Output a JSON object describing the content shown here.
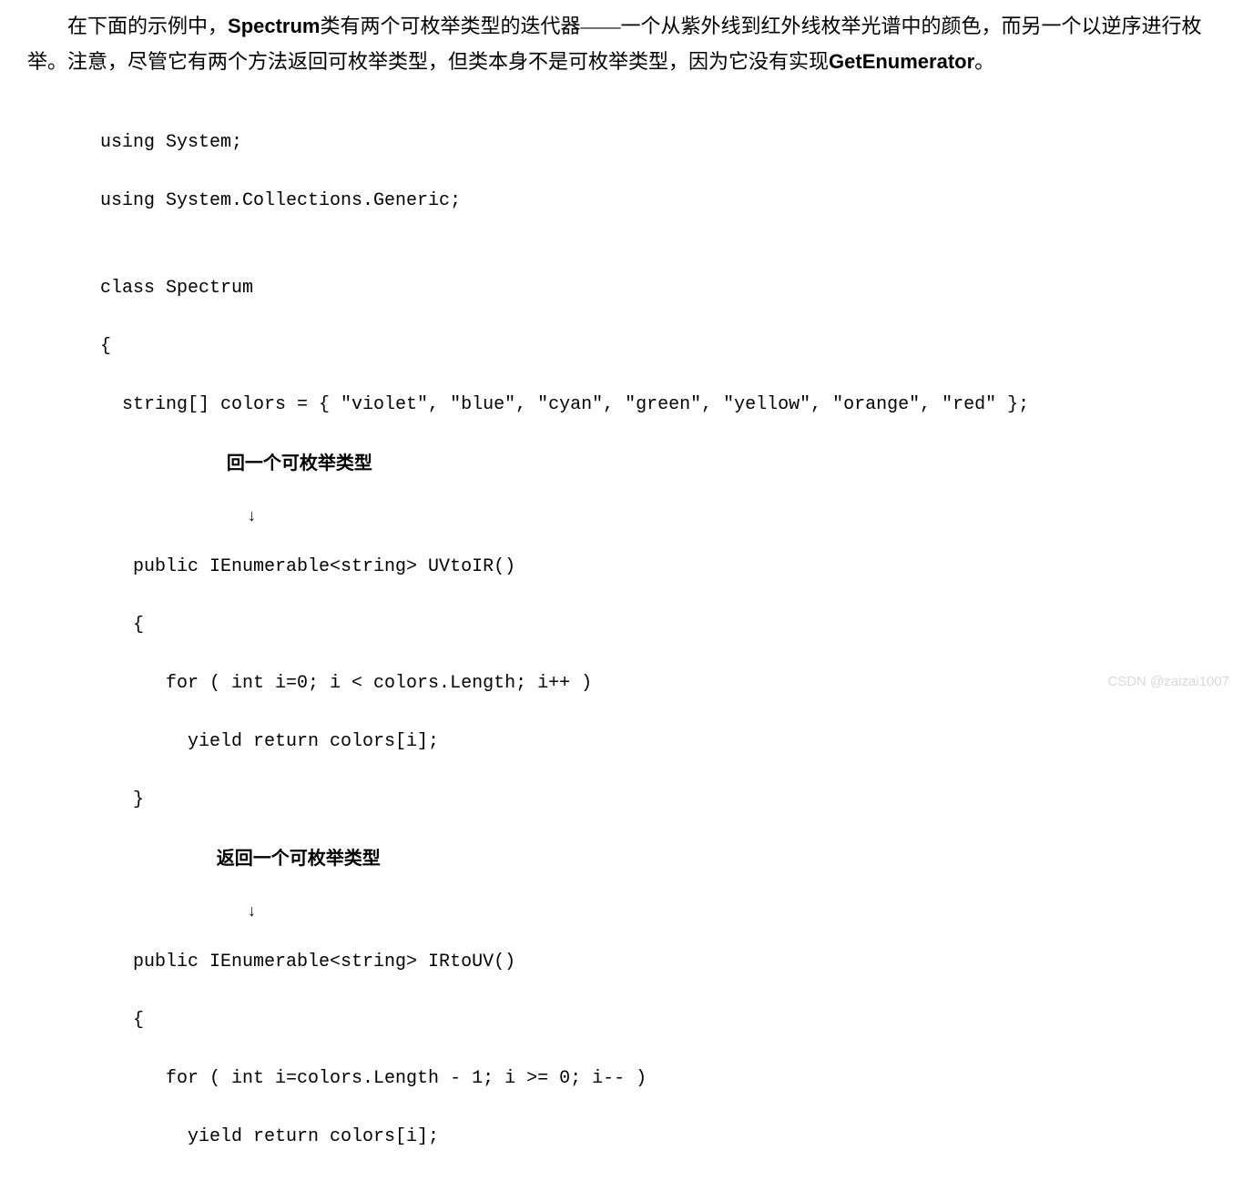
{
  "intro": {
    "part1": "在下面的示例中，",
    "latin1": "Spectrum",
    "part2": "类有两个可枚举类型的迭代器——一个从紫外线到红外线枚举光谱中的颜色，而另一个以逆序进行枚举。注意，尽管它有两个方法返回可枚举类型，但类本身不是可枚举类型，因为它没有实现",
    "latin2": "GetEnumerator",
    "part3": "。"
  },
  "code": {
    "l1": "using System;",
    "l2": "using System.Collections.Generic;",
    "l3": "",
    "l4": "class Spectrum",
    "l5": "{",
    "l6": "  string[] colors = { \"violet\", \"blue\", \"cyan\", \"green\", \"yellow\", \"orange\", \"red\" };",
    "ann1": "                         回一个可枚举类型",
    "arr1": "                                ↓",
    "l7": "   public IEnumerable<string> UVtoIR()",
    "l8": "   {",
    "l9": "      for ( int i=0; i < colors.Length; i++ )",
    "l10": "        yield return colors[i];",
    "l11": "   }",
    "ann2": "                       返回一个可枚举类型",
    "arr2": "                                ↓",
    "l12": "   public IEnumerable<string> IRtoUV()",
    "l13": "   {",
    "l14": "      for ( int i=colors.Length - 1; i >= 0; i-- )",
    "l15": "        yield return colors[i];"
  },
  "watermark": "CSDN @zaizai1007"
}
